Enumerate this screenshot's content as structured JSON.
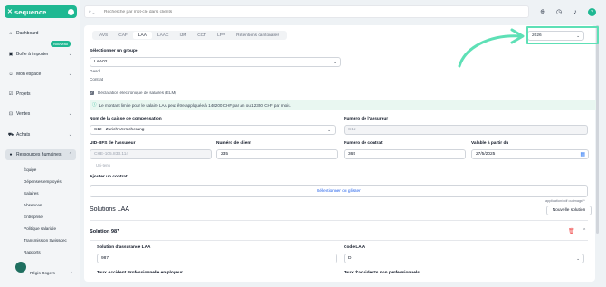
{
  "app": {
    "name": "sequence"
  },
  "sidebar": {
    "new_badge": "Nouveau",
    "items": [
      {
        "label": "Dashboard",
        "icon": "home-icon"
      },
      {
        "label": "Boîte à importer",
        "icon": "inbox-icon"
      },
      {
        "label": "Mon espace",
        "icon": "user-icon"
      },
      {
        "label": "Projets",
        "icon": "check-square-icon"
      },
      {
        "label": "Ventes",
        "icon": "lock-icon"
      },
      {
        "label": "Achats",
        "icon": "cart-icon"
      },
      {
        "label": "Ressources humaines",
        "icon": "people-icon"
      }
    ],
    "sub_items": [
      "Équipe",
      "Dépenses employés",
      "Salaires",
      "Absences",
      "Entreprise",
      "Politique salariale",
      "Transmission Swissdec",
      "Rapports"
    ],
    "user_name": "Régis Rogers"
  },
  "topbar": {
    "search_placeholder": "Recherche par mot-clé dans clients"
  },
  "tabs": [
    "AVS",
    "CAF",
    "LAA",
    "LAAC",
    "IJM",
    "CCT",
    "LPP",
    "Retentions cantonales"
  ],
  "year": "2026",
  "group": {
    "label": "Sélectionner un groupe",
    "value": "LAA02",
    "options": [
      "LAA02",
      "Gesol.",
      "Contrat"
    ]
  },
  "checkbox_label": "Déclaration électronique de salaires (ELM)",
  "info_text": "Le montant limite pour le salaire LAA peut être appliquée à 148200 CHF par an ou 12350 CHF par mois.",
  "fields": {
    "caisse_label": "Nom de la caisse de compensation",
    "caisse_value": "S12 - Zurich Versicherung",
    "assureur_num_label": "Numéro de l'assureur",
    "assureur_num_value": "S12",
    "uid_label": "UID-BFS de l'assureur",
    "uid_value": "CHE-105.833.114",
    "client_label": "Numéro de client",
    "client_value": "235",
    "contrat_label": "Numéro de contrat",
    "contrat_value": "365",
    "valid_label": "Valable à partir du",
    "valid_value": "27/5/2025",
    "muted_note": "Uni-tenu",
    "add_contract_label": "Ajouter un contrat",
    "add_contract_action": "Sélectionner ou glisser"
  },
  "solutions": {
    "title": "Solutions LAA",
    "new_button": "Nouvelle solution",
    "tooltip": "application/pdf ou image/*",
    "solution_title": "Solution 987",
    "insurance_solution_label": "Solution d'assurance LAA",
    "insurance_solution_value": "987",
    "code_label": "Code LAA",
    "code_value": "D",
    "taux_pro_label": "Taux Accident Professionnelle employeur",
    "taux_non_pro_label": "Taux d'accidents non professionnels"
  }
}
